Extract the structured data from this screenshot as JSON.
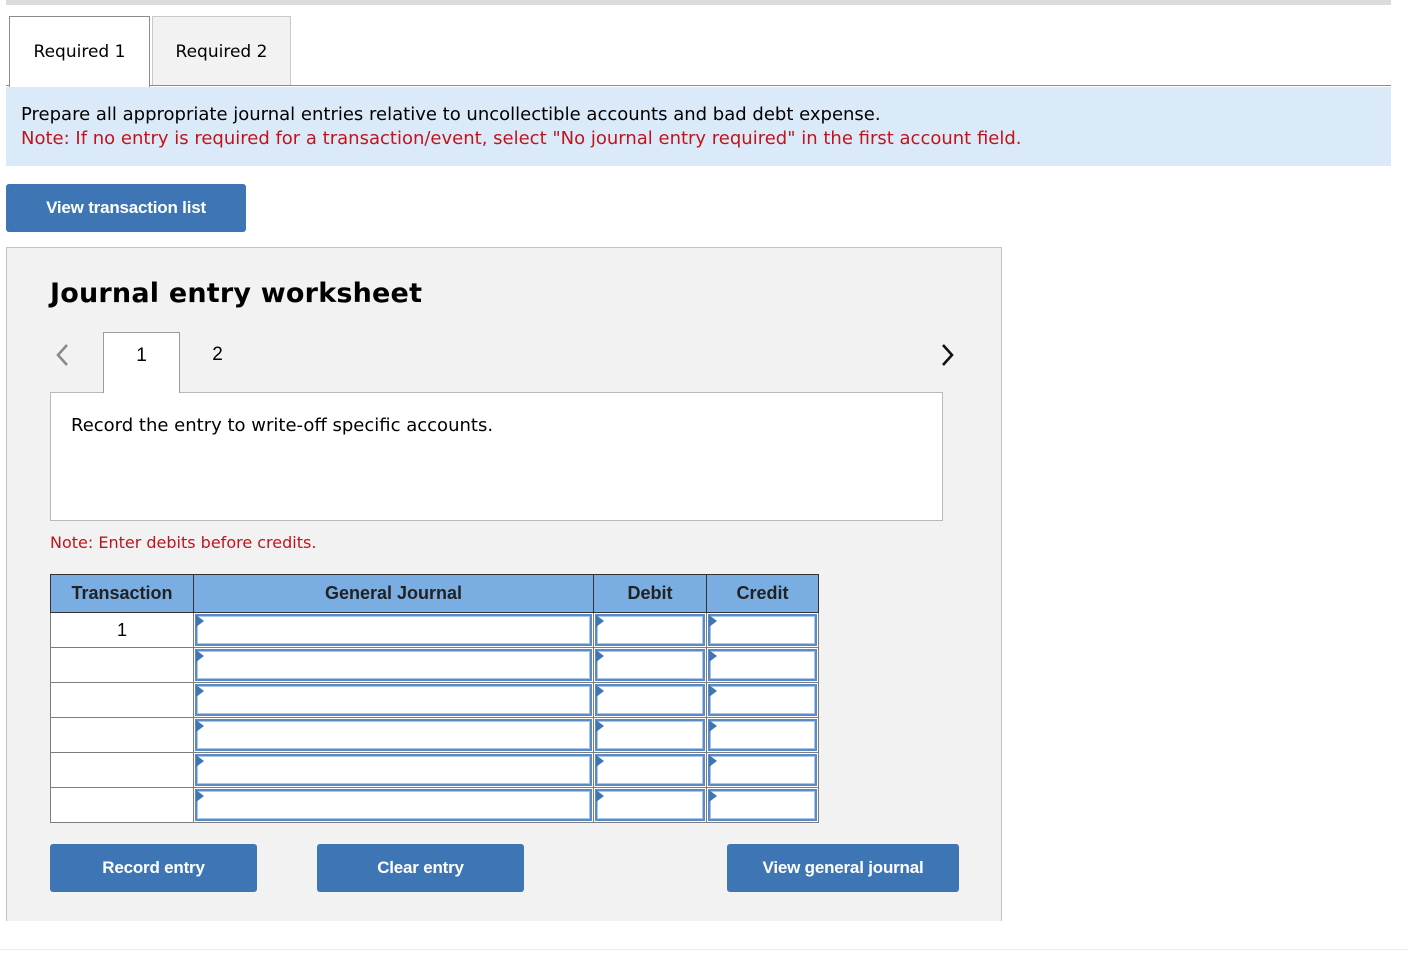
{
  "tabs": [
    {
      "label": "Required 1",
      "active": true
    },
    {
      "label": "Required 2",
      "active": false
    }
  ],
  "instructions": {
    "text": "Prepare all appropriate journal entries relative to uncollectible accounts and bad debt expense.",
    "note": "Note: If no entry is required for a transaction/event, select \"No journal entry required\" in the first account field."
  },
  "view_transaction_list_label": "View transaction list",
  "worksheet": {
    "title": "Journal entry worksheet",
    "prev_icon": "chevron-left-icon",
    "next_icon": "chevron-right-icon",
    "steps": [
      {
        "label": "1",
        "active": true
      },
      {
        "label": "2",
        "active": false
      }
    ],
    "description": "Record the entry to write-off specific accounts.",
    "note": "Note: Enter debits before credits.",
    "table": {
      "headers": [
        "Transaction",
        "General Journal",
        "Debit",
        "Credit"
      ],
      "rows": [
        {
          "transaction": "1",
          "account": "",
          "debit": "",
          "credit": ""
        },
        {
          "transaction": "",
          "account": "",
          "debit": "",
          "credit": ""
        },
        {
          "transaction": "",
          "account": "",
          "debit": "",
          "credit": ""
        },
        {
          "transaction": "",
          "account": "",
          "debit": "",
          "credit": ""
        },
        {
          "transaction": "",
          "account": "",
          "debit": "",
          "credit": ""
        },
        {
          "transaction": "",
          "account": "",
          "debit": "",
          "credit": ""
        }
      ]
    },
    "buttons": {
      "record": "Record entry",
      "clear": "Clear entry",
      "view_journal": "View general journal"
    }
  },
  "colors": {
    "accent": "#3e76b5",
    "header_blue": "#7aaee2",
    "instruction_bg": "#dbeaf8",
    "note_red": "#c0141d",
    "panel_bg": "#f2f2f2"
  }
}
